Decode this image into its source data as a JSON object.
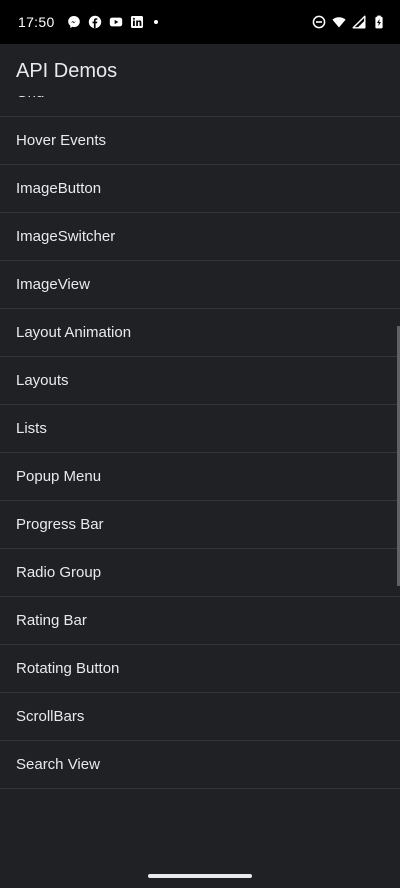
{
  "status_bar": {
    "time": "17:50",
    "left_icons": [
      "messenger-icon",
      "facebook-icon",
      "youtube-icon",
      "linkedin-icon",
      "notification-dot-icon"
    ],
    "right_icons": [
      "do-not-disturb-icon",
      "wifi-icon",
      "cellular-signal-icon",
      "battery-charging-icon"
    ]
  },
  "app_bar": {
    "title": "API Demos"
  },
  "list": {
    "items": [
      "Grid",
      "Hover Events",
      "ImageButton",
      "ImageSwitcher",
      "ImageView",
      "Layout Animation",
      "Layouts",
      "Lists",
      "Popup Menu",
      "Progress Bar",
      "Radio Group",
      "Rating Bar",
      "Rotating Button",
      "ScrollBars",
      "Search View"
    ]
  },
  "colors": {
    "background": "#202124",
    "status_bar": "#000000",
    "text": "#e8eaed",
    "divider": "#34353a"
  }
}
